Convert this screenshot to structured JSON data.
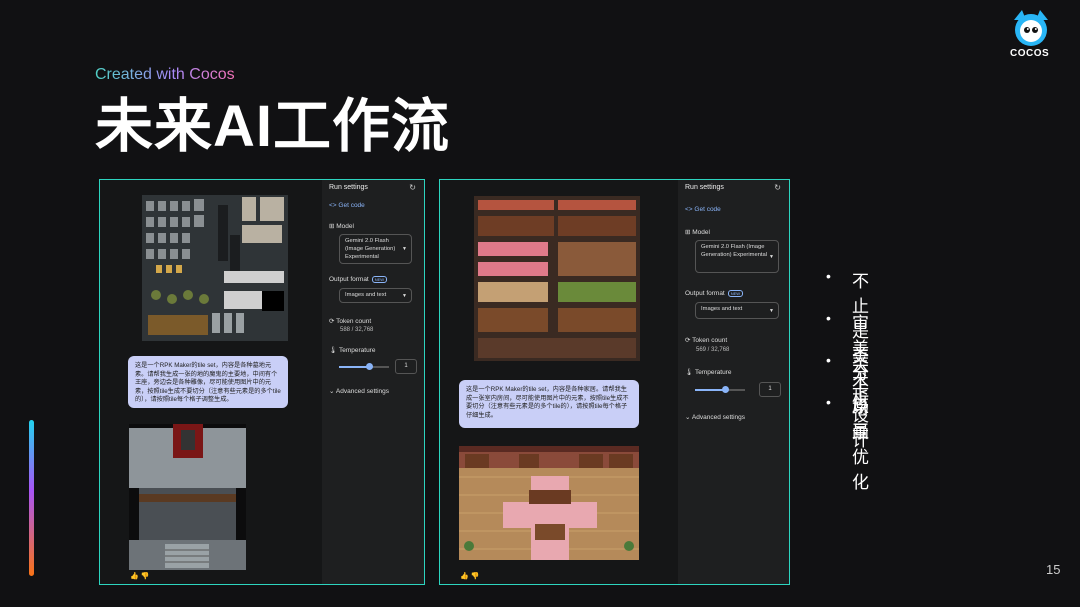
{
  "slide": {
    "subtitle": "Created with Cocos",
    "title": "未来AI工作流",
    "logo_text": "COCOS",
    "page_number": "15"
  },
  "bullets": [
    "不止是美术原画",
    "审美分析",
    "关卡设计",
    "场景优化"
  ],
  "panel1": {
    "settings": {
      "header": "Run settings",
      "get_code": "Get code",
      "model_label": "Model",
      "model_value": "Gemini 2.0 Flash (Image Generation) Experimental",
      "output_format_label": "Output format",
      "new_badge": "NEW",
      "output_format_value": "Images and text",
      "token_count_label": "Token count",
      "token_count_value": "588 / 32,768",
      "temperature_label": "Temperature",
      "temperature_value": "1",
      "advanced_label": "Advanced settings"
    },
    "prompt": "这是一个RPK Maker的tile set，内容是各种墓地元素。请帮我生成一张的地的魔鬼的主要地，中间有个王座，旁边会是各种雕像，尽可能使用图片中的元素，按照tile生成不要切分（注意有些元素是的多个tile的），请按照tile每个格子调整生成。"
  },
  "panel2": {
    "settings": {
      "header": "Run settings",
      "get_code": "Get code",
      "model_label": "Model",
      "model_value": "Gemini 2.0 Flash (Image Generation) Experimental",
      "output_format_label": "Output format",
      "new_badge": "NEW",
      "output_format_value": "Images and text",
      "token_count_label": "Token count",
      "token_count_value": "569 / 32,768",
      "temperature_label": "Temperature",
      "temperature_value": "1",
      "advanced_label": "Advanced settings"
    },
    "prompt": "这是一个RPK Maker的tile set，内容是各种家居。请帮我生成一张室内房间，尽可能使用图片中的元素，按照tile生成不要切分（注意有些元素是的多个tile的），请按照tile每个格子仔细生成。"
  },
  "colors": {
    "background": "#111113",
    "panel_border": "#2dd4bf",
    "prompt_bubble": "#c9cff7",
    "link_blue": "#8ab4f8"
  }
}
